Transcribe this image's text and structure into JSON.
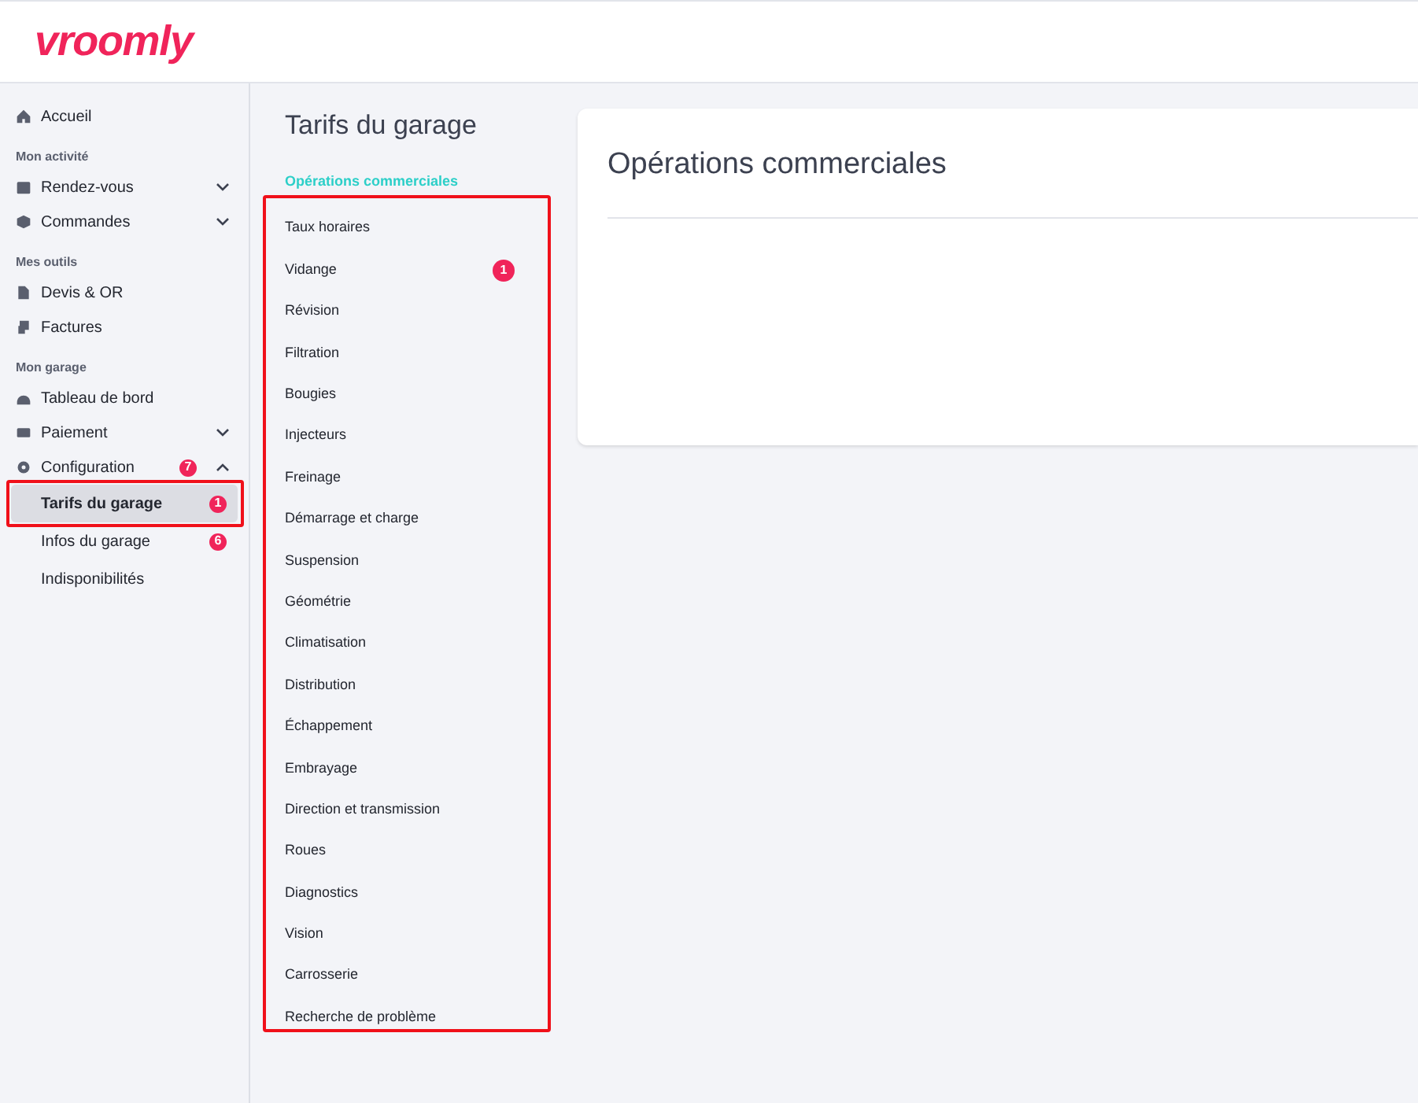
{
  "header": {
    "logo": "vroomly"
  },
  "sidebar": {
    "top": [
      {
        "label": "Accueil"
      }
    ],
    "sections": [
      {
        "heading": "Mon activité",
        "items": [
          {
            "label": "Rendez-vous",
            "expanded": false
          },
          {
            "label": "Commandes",
            "expanded": false
          }
        ]
      },
      {
        "heading": "Mes outils",
        "items": [
          {
            "label": "Devis & OR"
          },
          {
            "label": "Factures"
          }
        ]
      },
      {
        "heading": "Mon garage",
        "items": [
          {
            "label": "Tableau de bord"
          },
          {
            "label": "Paiement",
            "expanded": false
          },
          {
            "label": "Configuration",
            "badge": "7",
            "expanded": true,
            "children": [
              {
                "label": "Tarifs du garage",
                "badge": "1",
                "selected": true
              },
              {
                "label": "Infos du garage",
                "badge": "6",
                "selected": false
              },
              {
                "label": "Indisponibilités",
                "selected": false
              }
            ]
          }
        ]
      }
    ]
  },
  "submenu": {
    "title": "Tarifs du garage",
    "heading": "Opérations commerciales",
    "items": [
      {
        "label": "Taux horaires"
      },
      {
        "label": "Vidange",
        "badge": "1"
      },
      {
        "label": "Révision"
      },
      {
        "label": "Filtration"
      },
      {
        "label": "Bougies"
      },
      {
        "label": "Injecteurs"
      },
      {
        "label": "Freinage"
      },
      {
        "label": "Démarrage et charge"
      },
      {
        "label": "Suspension"
      },
      {
        "label": "Géométrie"
      },
      {
        "label": "Climatisation"
      },
      {
        "label": "Distribution"
      },
      {
        "label": "Échappement"
      },
      {
        "label": "Embrayage"
      },
      {
        "label": "Direction et transmission"
      },
      {
        "label": "Roues"
      },
      {
        "label": "Diagnostics"
      },
      {
        "label": "Vision"
      },
      {
        "label": "Carrosserie"
      },
      {
        "label": "Recherche de problème"
      }
    ]
  },
  "card": {
    "title": "Opérations commerciales"
  }
}
